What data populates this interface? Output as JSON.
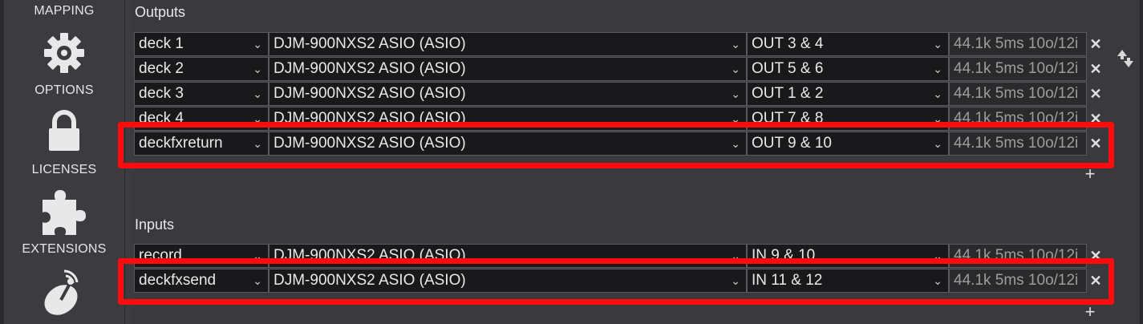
{
  "sidebar": {
    "mapping_label": "MAPPING",
    "options_label": "OPTIONS",
    "licenses_label": "LICENSES",
    "extensions_label": "EXTENSIONS",
    "icons": [
      "gear-icon",
      "lock-icon",
      "puzzle-icon",
      "satellite-dish-icon"
    ]
  },
  "outputs": {
    "title": "Outputs",
    "rows": [
      {
        "name": "deck 1",
        "device": "DJM-900NXS2 ASIO (ASIO)",
        "channels": "OUT 3 & 4",
        "info": "44.1k 5ms 10o/12i"
      },
      {
        "name": "deck 2",
        "device": "DJM-900NXS2 ASIO (ASIO)",
        "channels": "OUT 5 & 6",
        "info": "44.1k 5ms 10o/12i"
      },
      {
        "name": "deck 3",
        "device": "DJM-900NXS2 ASIO (ASIO)",
        "channels": "OUT 1 & 2",
        "info": "44.1k 5ms 10o/12i"
      },
      {
        "name": "deck 4",
        "device": "DJM-900NXS2 ASIO (ASIO)",
        "channels": "OUT 7 & 8",
        "info": "44.1k 5ms 10o/12i"
      },
      {
        "name": "deckfxreturn",
        "device": "DJM-900NXS2 ASIO (ASIO)",
        "channels": "OUT 9 & 10",
        "info": "44.1k 5ms 10o/12i"
      }
    ],
    "add_label": "+"
  },
  "inputs": {
    "title": "Inputs",
    "rows": [
      {
        "name": "record",
        "device": "DJM-900NXS2 ASIO (ASIO)",
        "channels": "IN 9 & 10",
        "info": "44.1k 5ms 10o/12i"
      },
      {
        "name": "deckfxsend",
        "device": "DJM-900NXS2 ASIO (ASIO)",
        "channels": "IN 11 & 12",
        "info": "44.1k 5ms 10o/12i"
      }
    ],
    "add_label": "+"
  },
  "glyphs": {
    "caret": "⌄",
    "remove": "✕"
  },
  "colors": {
    "highlight": "#ff0b0b",
    "background": "#3a3a3e",
    "cell": "#19191b"
  }
}
